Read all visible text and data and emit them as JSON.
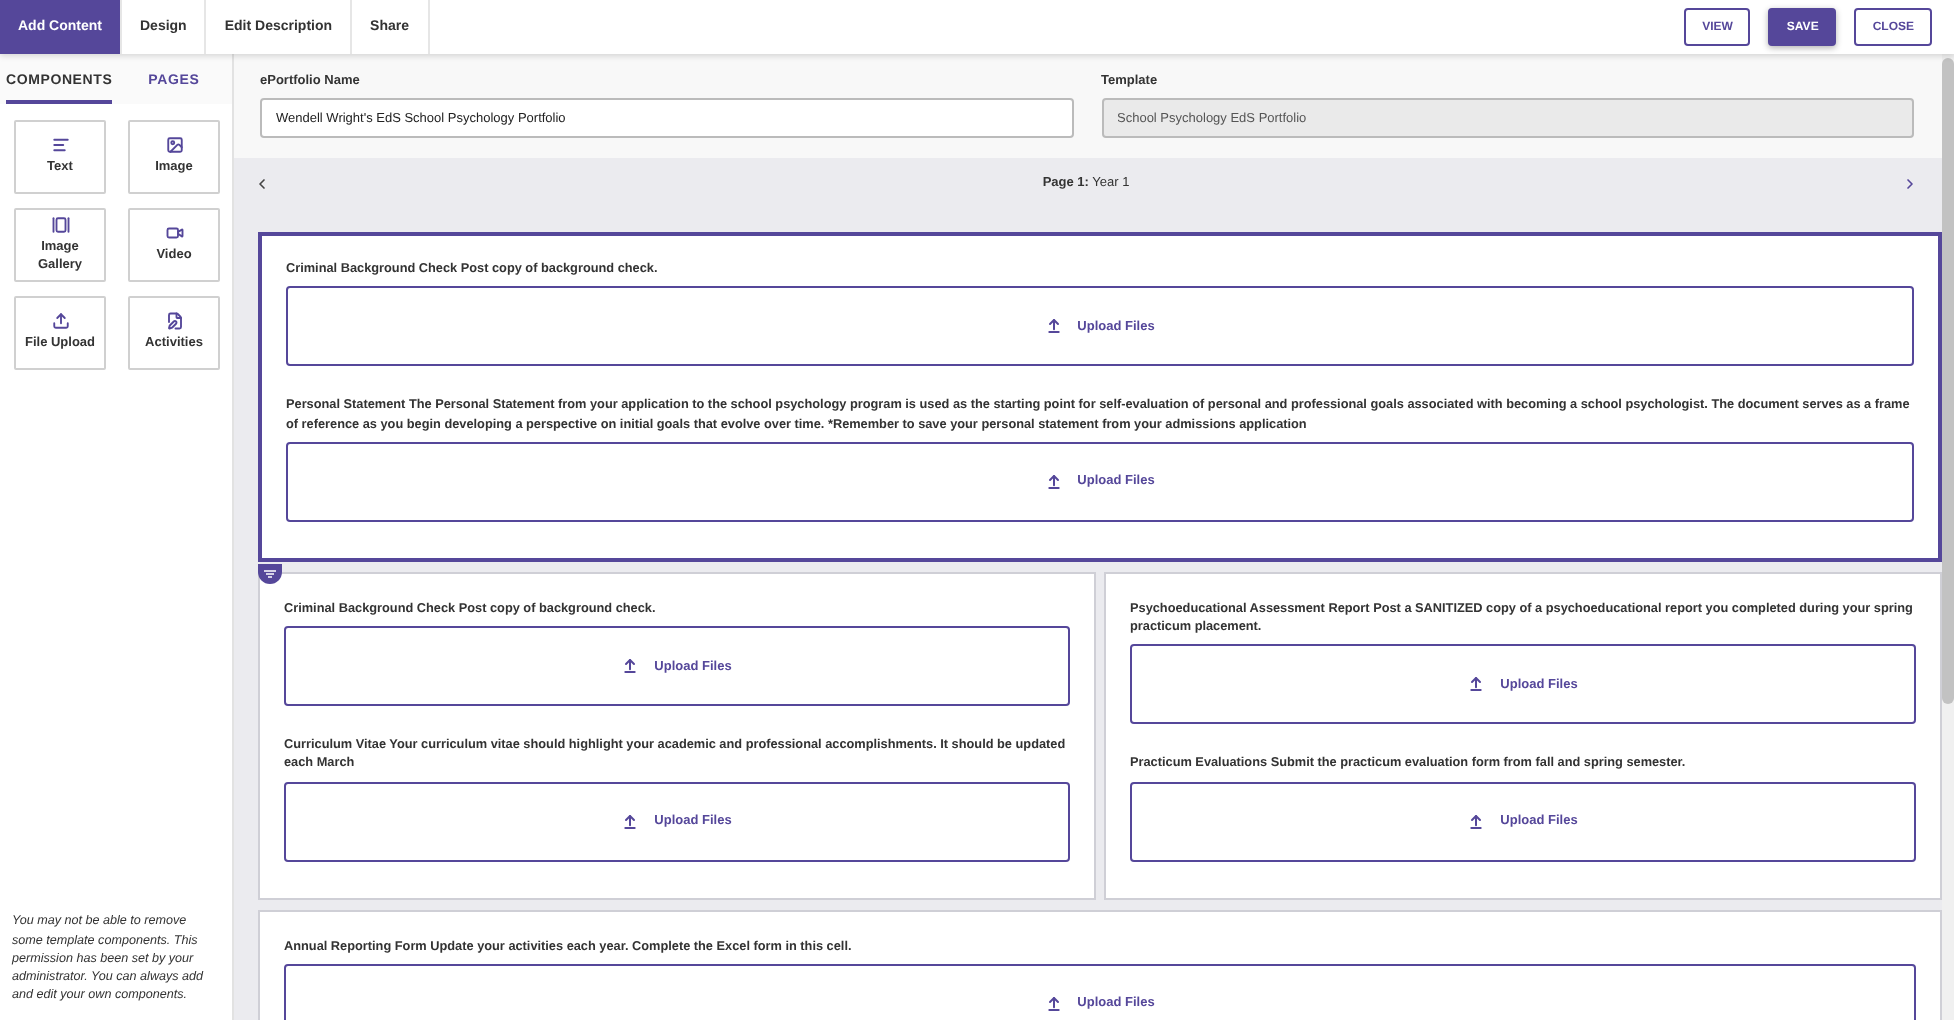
{
  "top_tabs": [
    {
      "label": "Add Content",
      "selected": true
    },
    {
      "label": "Design",
      "selected": false
    },
    {
      "label": "Edit Description",
      "selected": false
    },
    {
      "label": "Share",
      "selected": false
    }
  ],
  "actions": [
    {
      "label": "VIEW",
      "kind": "outline"
    },
    {
      "label": "SAVE",
      "kind": "primary"
    },
    {
      "label": "CLOSE",
      "kind": "outline"
    }
  ],
  "sidebar": {
    "tabs": [
      {
        "label": "COMPONENTS",
        "selected": true
      },
      {
        "label": "PAGES",
        "selected": false
      }
    ],
    "components": [
      {
        "label": "Text",
        "kind": "text"
      },
      {
        "label": "Image",
        "kind": "image"
      },
      {
        "label": "Image Gallery",
        "kind": "gallery"
      },
      {
        "label": "Video",
        "kind": "video"
      },
      {
        "label": "File Upload",
        "kind": "upload"
      },
      {
        "label": "Activities",
        "kind": "activities"
      }
    ],
    "note": "You may not be able to remove some template components. This permission has been set by your administrator. You can always add and edit your own components."
  },
  "form": {
    "name_label": "ePortfolio Name",
    "name_value": "Wendell Wright's EdS School Psychology Portfolio",
    "template_label": "Template",
    "template_value": "School Psychology EdS Portfolio",
    "template_disabled": true
  },
  "pager": {
    "text": "**Page 1:** Year 1"
  },
  "sections": [
    {
      "selected": true,
      "columns": [
        [
          {
            "label": "Criminal Background Check Post copy of background check.",
            "button": "Upload Files"
          },
          {
            "label": "Personal Statement The Personal Statement from your application to the school psychology program is used as the starting point for self-evaluation of personal and professional goals associated with becoming a school psychologist. The document serves as a frame of reference as you begin developing a perspective on initial goals that evolve over time. *Remember to save your personal statement from your admissions application",
            "button": "Upload Files"
          }
        ]
      ]
    },
    {
      "selected": false,
      "columns": [
        [
          {
            "label": "Criminal Background Check Post copy of background check.",
            "button": "Upload Files"
          },
          {
            "label": "Curriculum Vitae Your curriculum vitae should highlight your academic and professional accomplishments. It should be updated each March",
            "button": "Upload Files"
          }
        ],
        [
          {
            "label": "Psychoeducational Assessment Report Post a SANITIZED copy of a psychoeducational report you completed during your spring practicum placement.",
            "button": "Upload Files"
          },
          {
            "label": "Practicum Evaluations Submit the practicum evaluation form from fall and spring semester.",
            "button": "Upload Files"
          }
        ]
      ]
    },
    {
      "selected": false,
      "columns": [
        [
          {
            "label": "Annual Reporting Form Update your activities each year. Complete the Excel form in this cell.",
            "button": "Upload Files"
          }
        ]
      ]
    }
  ]
}
